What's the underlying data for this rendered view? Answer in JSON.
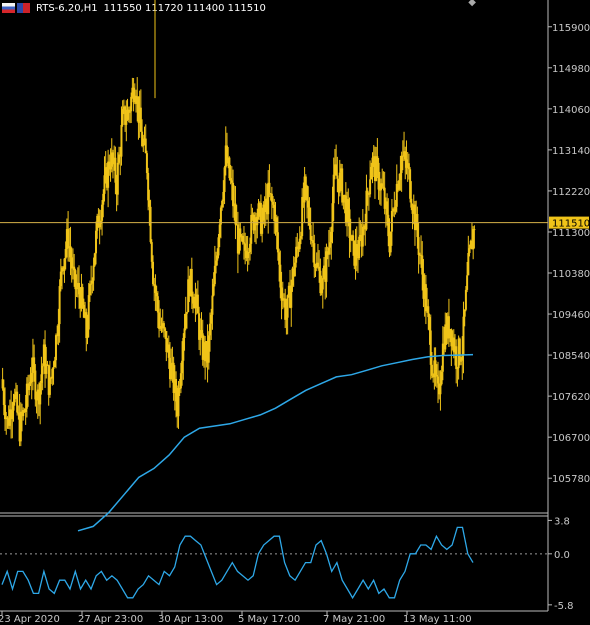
{
  "header": {
    "symbol": "RTS-6.20,H1",
    "ohlc": "111550 111720 111400 111510",
    "icons": [
      "flag-left-icon",
      "flag-right-icon",
      "collapse-icon"
    ]
  },
  "colors": {
    "background": "#000000",
    "candles": "#f0c419",
    "moving_average": "#2ea8e8",
    "indicator": "#2ea8e8",
    "price_line": "#d8b24a",
    "price_tag_bg": "#f0c419",
    "axis_text": "#c8c8c8"
  },
  "chart_data": [
    {
      "type": "candlestick",
      "series_label": "RTS-6.20,H1",
      "y_ticks": [
        "115900",
        "114980",
        "114060",
        "113140",
        "112220",
        "111300",
        "110380",
        "109460",
        "108540",
        "107620",
        "106700",
        "105780"
      ],
      "ylim": [
        105000,
        116500
      ],
      "current_price": "111510",
      "x_ticks": [
        "23 Apr 2020",
        "27 Apr 23:00",
        "30 Apr 13:00",
        "5 May 17:00",
        "7 May 21:00",
        "13 May 11:00"
      ],
      "close_path": [
        108000,
        107000,
        107700,
        106900,
        107400,
        108300,
        107600,
        108500,
        107800,
        108900,
        110600,
        111200,
        110100,
        109900,
        109000,
        110500,
        111600,
        112300,
        113000,
        112400,
        113800,
        114000,
        114700,
        113500,
        112800,
        110400,
        109300,
        108900,
        108200,
        107400,
        109100,
        110200,
        109800,
        108700,
        108500,
        110000,
        111700,
        113000,
        112200,
        111100,
        110800,
        111300,
        111800,
        111500,
        112100,
        111800,
        110200,
        109400,
        110300,
        111100,
        112200,
        111400,
        110500,
        110100,
        111000,
        112600,
        112400,
        111700,
        110800,
        110900,
        111700,
        112900,
        112600,
        112100,
        111100,
        112200,
        113000,
        112700,
        111800,
        110800,
        109700,
        108400,
        107600,
        109000,
        109200,
        108500,
        108700,
        110500,
        111510
      ],
      "moving_average": [
        104600,
        104700,
        105000,
        105400,
        105800,
        106000,
        106300,
        106700,
        106900,
        106950,
        107000,
        107100,
        107200,
        107350,
        107550,
        107750,
        107900,
        108050,
        108100,
        108200,
        108300,
        108370,
        108440,
        108500,
        108530,
        108540,
        108550
      ]
    },
    {
      "type": "line",
      "y_ticks": [
        "3.8",
        "0.0",
        "-5.8"
      ],
      "ylim": [
        -6.5,
        4.3
      ],
      "values": [
        -3.5,
        -2,
        -4,
        -2,
        -2,
        -3,
        -4.5,
        -4.5,
        -2,
        -4,
        -4.5,
        -3,
        -3,
        -4,
        -2,
        -4,
        -3,
        -4,
        -2.5,
        -2,
        -3,
        -2.5,
        -3,
        -4,
        -5,
        -5,
        -4,
        -3.5,
        -2.5,
        -3,
        -3.5,
        -2,
        -2.5,
        -1.5,
        1,
        2,
        2,
        1.5,
        1,
        -0.5,
        -2,
        -3.5,
        -3,
        -2,
        -1,
        -2,
        -2.5,
        -3,
        -2.5,
        0,
        1,
        1.5,
        2,
        2,
        -1,
        -2.5,
        -3,
        -2,
        -1,
        -1,
        1,
        1.5,
        0,
        -2,
        -1,
        -3,
        -4,
        -5,
        -4,
        -3,
        -4,
        -3,
        -4.5,
        -4,
        -5,
        -5,
        -3,
        -2,
        0,
        0,
        1,
        1,
        0.5,
        2,
        1,
        0.5,
        1,
        3,
        3,
        0,
        -1
      ]
    }
  ]
}
